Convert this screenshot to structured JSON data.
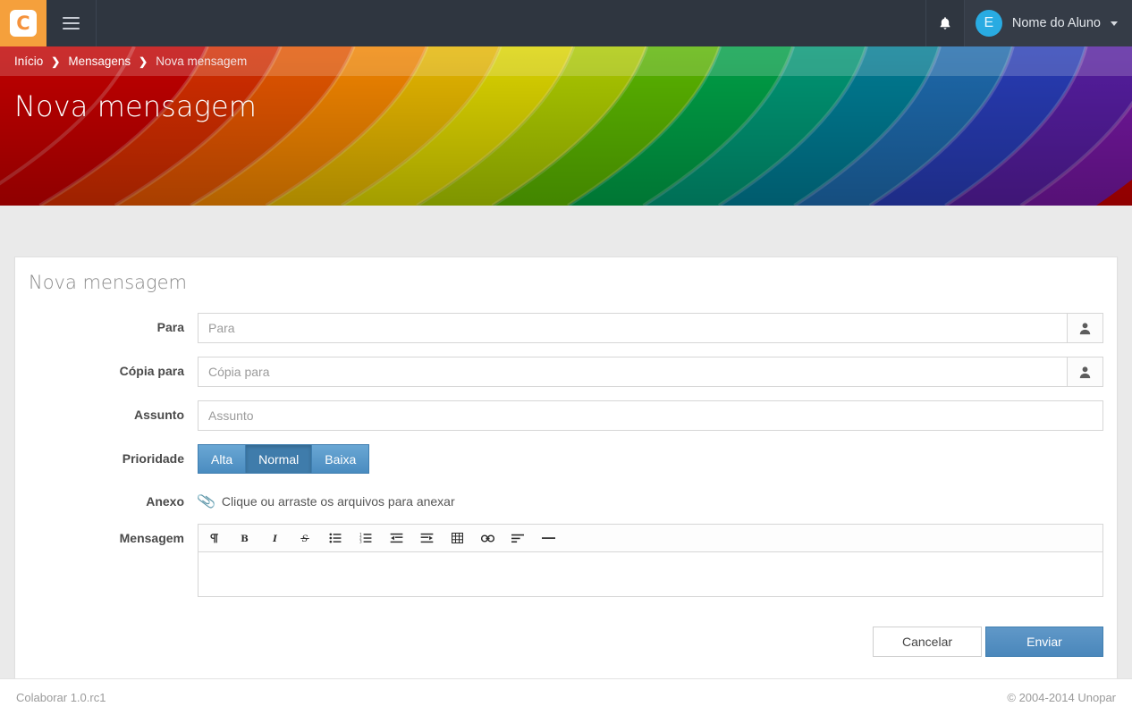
{
  "navbar": {
    "brand_letter": "C",
    "menu_toggle": "hamburger-menu",
    "notification_icon": "bell-icon",
    "user": {
      "avatar_letter": "E",
      "name": "Nome do Aluno"
    }
  },
  "banner": {
    "breadcrumb": [
      {
        "label": "Início",
        "current": false
      },
      {
        "label": "Mensagens",
        "current": false
      },
      {
        "label": "Nova mensagem",
        "current": true
      }
    ],
    "separator": "❯",
    "page_title": "Nova mensagem",
    "colors": [
      "#cc0000",
      "#e03000",
      "#f05a00",
      "#ff8c00",
      "#f2c000",
      "#e8e000",
      "#b5d400",
      "#5fbe00",
      "#00a84a",
      "#009e7a",
      "#00829b",
      "#1f6fb5",
      "#2a3fbf",
      "#5a1fa8",
      "#7a18a8"
    ]
  },
  "card": {
    "title": "Nova mensagem",
    "fields": {
      "to": {
        "label": "Para",
        "value": "",
        "placeholder": "Para",
        "addon_icon": "user-picker-icon"
      },
      "cc": {
        "label": "Cópia para",
        "value": "",
        "placeholder": "Cópia para",
        "addon_icon": "user-picker-icon"
      },
      "subject": {
        "label": "Assunto",
        "value": "",
        "placeholder": "Assunto"
      },
      "priority": {
        "label": "Prioridade",
        "options": [
          "Alta",
          "Normal",
          "Baixa"
        ],
        "selected": "Normal"
      },
      "attachment": {
        "label": "Anexo",
        "hint": "Clique ou arraste os arquivos para anexar",
        "icon": "paperclip-icon"
      },
      "message": {
        "label": "Mensagem",
        "value": "",
        "toolbar": [
          {
            "name": "paragraph-icon",
            "title": "Parágrafo"
          },
          {
            "name": "bold-icon",
            "title": "Negrito"
          },
          {
            "name": "italic-icon",
            "title": "Itálico"
          },
          {
            "name": "strikethrough-icon",
            "title": "Tachado"
          },
          {
            "name": "unordered-list-icon",
            "title": "Lista com marcadores"
          },
          {
            "name": "ordered-list-icon",
            "title": "Lista numerada"
          },
          {
            "name": "outdent-icon",
            "title": "Diminuir recuo"
          },
          {
            "name": "indent-icon",
            "title": "Aumentar recuo"
          },
          {
            "name": "table-icon",
            "title": "Tabela"
          },
          {
            "name": "link-icon",
            "title": "Link"
          },
          {
            "name": "align-left-icon",
            "title": "Alinhar"
          },
          {
            "name": "horizontal-rule-icon",
            "title": "Linha horizontal"
          }
        ]
      }
    },
    "actions": {
      "cancel": "Cancelar",
      "submit": "Enviar"
    }
  },
  "footer": {
    "left": "Colaborar 1.0.rc1",
    "right": "© 2004-2014 Unopar"
  }
}
